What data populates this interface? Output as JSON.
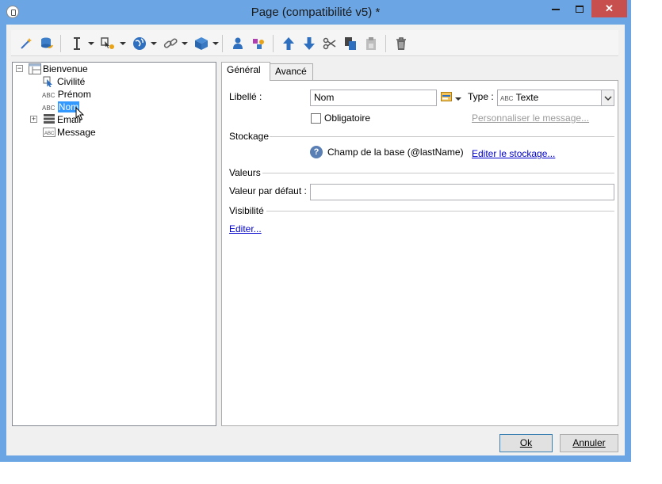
{
  "window": {
    "title": "Page (compatibilité v5) *",
    "close_label": "✕"
  },
  "toolbar": {
    "icons": [
      "wizard-icon",
      "database-undo-icon",
      "insert-cursor-icon",
      "field-add-icon",
      "globe-icon",
      "link-icon",
      "box-icon",
      "user-icon",
      "shapes-icon",
      "arrow-up-icon",
      "arrow-down-icon",
      "cut-icon",
      "copy-icon",
      "paste-icon",
      "delete-icon"
    ]
  },
  "tree": {
    "items": [
      {
        "label": "Bienvenue"
      },
      {
        "label": "Civilité"
      },
      {
        "label": "Prénom",
        "prefix": "ABC"
      },
      {
        "label": "Nom",
        "prefix": "ABC"
      },
      {
        "label": "Email"
      },
      {
        "label": "Message"
      }
    ]
  },
  "tabs": [
    {
      "label": "Général"
    },
    {
      "label": "Avancé"
    }
  ],
  "general": {
    "libelle_label": "Libellé :",
    "libelle_value": "Nom",
    "type_label": "Type :",
    "type_prefix": "ABC",
    "type_value": "Texte",
    "obligatoire_label": "Obligatoire",
    "personnaliser_link": "Personnaliser le message...",
    "stockage_header": "Stockage",
    "champ_text": "Champ de la base (@lastName)",
    "editer_stockage_link": "Editer le stockage...",
    "valeurs_header": "Valeurs",
    "defaut_label": "Valeur par défaut :",
    "defaut_value": "",
    "visibilite_header": "Visibilité",
    "editer_link": "Editer..."
  },
  "buttons": {
    "ok": "Ok",
    "annuler": "Annuler"
  }
}
